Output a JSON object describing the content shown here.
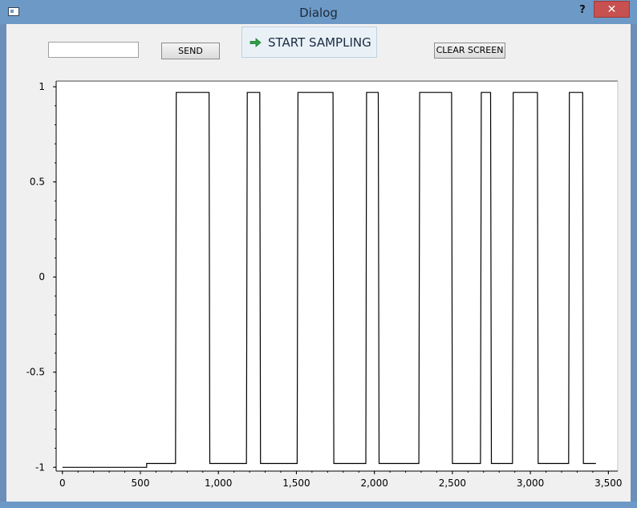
{
  "window": {
    "title": "Dialog",
    "help_label": "?",
    "close_label": "✕"
  },
  "toolbar": {
    "input_value": "",
    "send_label": "SEND",
    "start_label": "START SAMPLING",
    "start_icon": "green-arrow-right-icon",
    "clear_label": "CLEAR SCREEN"
  },
  "chart_data": {
    "type": "line",
    "title": "",
    "xlabel": "",
    "ylabel": "",
    "xlim": [
      -40,
      3560
    ],
    "ylim": [
      -1.02,
      1.03
    ],
    "x_ticks": [
      0,
      500,
      1000,
      1500,
      2000,
      2500,
      3000,
      3500
    ],
    "x_tick_labels": [
      "0",
      "500",
      "1,000",
      "1,500",
      "2,000",
      "2,500",
      "3,000",
      "3,500"
    ],
    "y_ticks": [
      -1,
      -0.5,
      0,
      0.5,
      1
    ],
    "y_tick_labels": [
      "-1",
      "-0.5",
      "0",
      "0.5",
      "1"
    ],
    "grid": false,
    "line_color": "#000000",
    "series": [
      {
        "x": [
          0,
          540,
          540,
          725,
          730,
          940,
          945,
          1180,
          1185,
          1265,
          1270,
          1505,
          1510,
          1735,
          1740,
          1945,
          1950,
          2025,
          2030,
          2285,
          2290,
          2495,
          2500,
          2680,
          2685,
          2745,
          2750,
          2885,
          2890,
          3045,
          3050,
          3245,
          3250,
          3335,
          3340,
          3420
        ],
        "y": [
          -1.0,
          -1.0,
          -0.98,
          -0.98,
          0.97,
          0.97,
          -0.98,
          -0.98,
          0.97,
          0.97,
          -0.98,
          -0.98,
          0.97,
          0.97,
          -0.98,
          -0.98,
          0.97,
          0.97,
          -0.98,
          -0.98,
          0.97,
          0.97,
          -0.98,
          -0.98,
          0.97,
          0.97,
          -0.98,
          -0.98,
          0.97,
          0.97,
          -0.98,
          -0.98,
          0.97,
          0.97,
          -0.98,
          -0.98
        ]
      }
    ]
  }
}
